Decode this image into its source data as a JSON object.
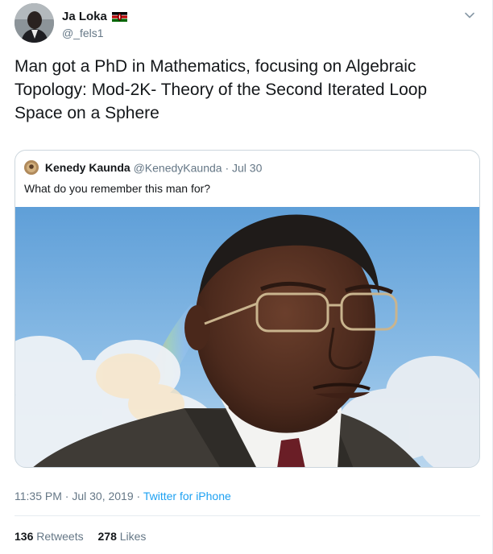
{
  "author": {
    "display_name": "Ja Loka",
    "handle": "@_fels1",
    "flag_icon": "kenya-flag-icon"
  },
  "tweet": {
    "text": "Man got a PhD in Mathematics, focusing on Algebraic Topology: Mod-2K- Theory of the Second Iterated Loop Space on a Sphere"
  },
  "quoted_tweet": {
    "display_name": "Kenedy Kaunda",
    "handle": "@KenedyKaunda",
    "separator": "·",
    "date": "Jul 30",
    "text": "What do you remember this man for?"
  },
  "meta": {
    "time": "11:35 PM",
    "separator1": "·",
    "date": "Jul 30, 2019",
    "separator2": "·",
    "source": "Twitter for iPhone"
  },
  "stats": {
    "retweets_count": "136",
    "retweets_label": "Retweets",
    "likes_count": "278",
    "likes_label": "Likes"
  },
  "colors": {
    "link": "#1da1f2",
    "secondary_text": "#657786",
    "border": "#ccd6dd"
  }
}
